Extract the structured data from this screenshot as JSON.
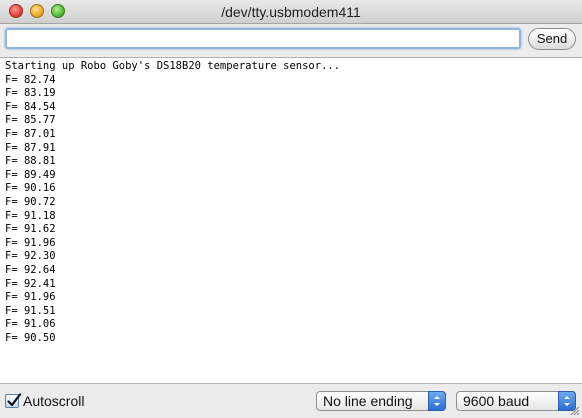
{
  "window": {
    "title": "/dev/tty.usbmodem411"
  },
  "input": {
    "value": "",
    "placeholder": ""
  },
  "toolbar": {
    "send_label": "Send"
  },
  "output": {
    "lines": [
      "Starting up Robo Goby's DS18B20 temperature sensor...",
      "F= 82.74",
      "F= 83.19",
      "F= 84.54",
      "F= 85.77",
      "F= 87.01",
      "F= 87.91",
      "F= 88.81",
      "F= 89.49",
      "F= 90.16",
      "F= 90.72",
      "F= 91.18",
      "F= 91.62",
      "F= 91.96",
      "F= 92.30",
      "F= 92.64",
      "F= 92.41",
      "F= 91.96",
      "F= 91.51",
      "F= 91.06",
      "F= 90.50"
    ]
  },
  "footer": {
    "autoscroll_label": "Autoscroll",
    "autoscroll_checked": true,
    "line_ending_selected": "No line ending",
    "baud_selected": "9600 baud"
  },
  "icons": {
    "close": "close-icon",
    "minimize": "minimize-icon",
    "maximize": "maximize-icon",
    "checkmark": "checkmark-icon",
    "select_arrows": "select-arrows-icon",
    "resize": "resize-grip-icon"
  },
  "colors": {
    "close": "#e0443a",
    "minimize": "#e7a92a",
    "maximize": "#57b93a",
    "focus_ring": "#8fb5e0",
    "select_accent": "#2a6fd6"
  }
}
